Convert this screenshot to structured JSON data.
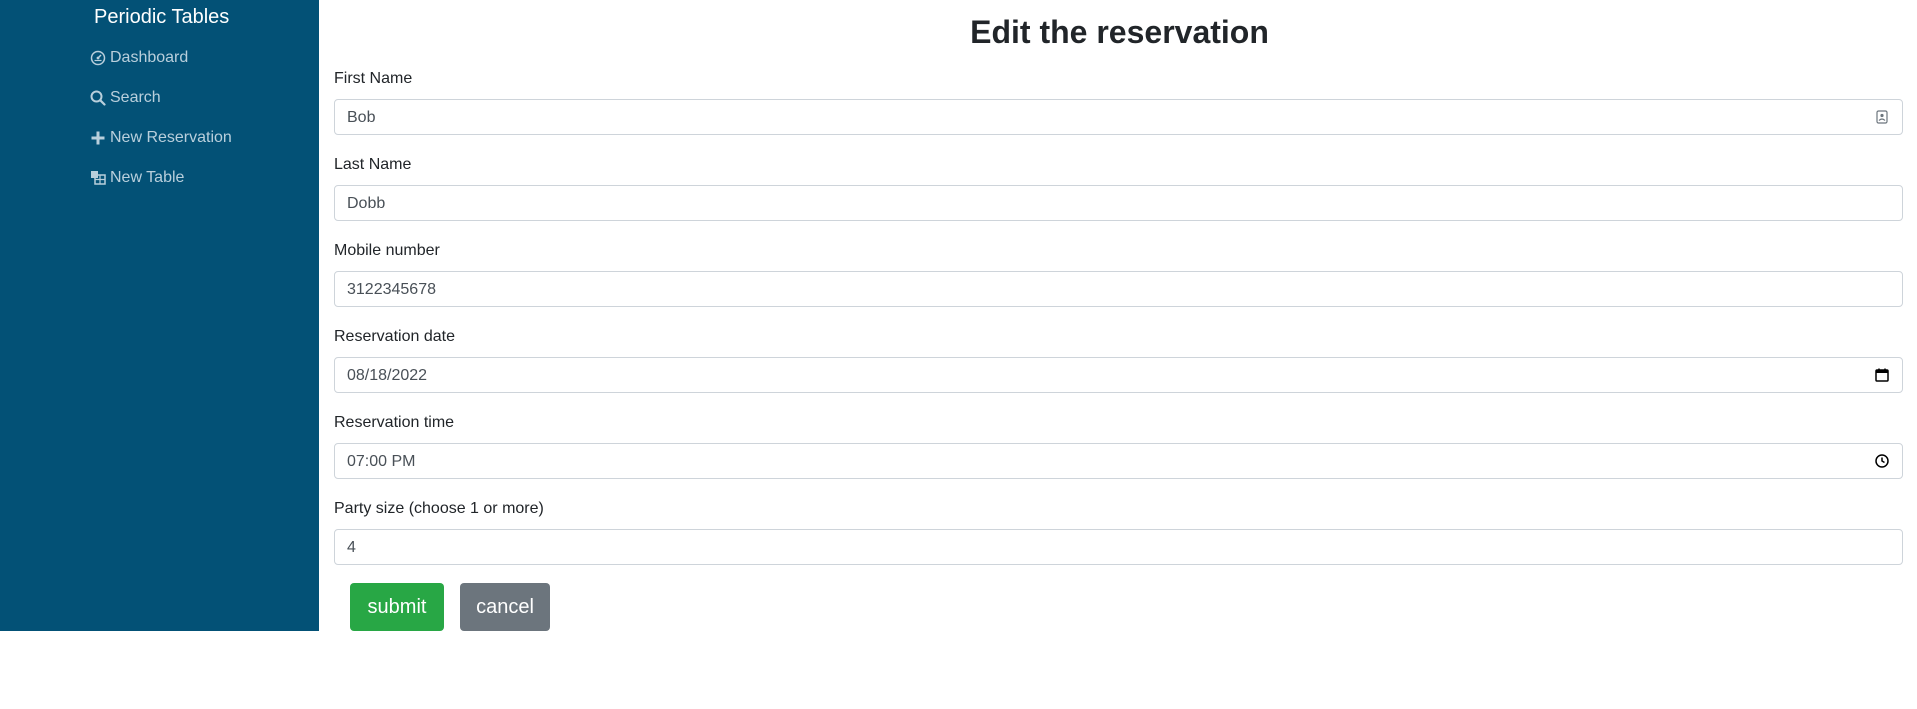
{
  "sidebar": {
    "brand": "Periodic Tables",
    "items": [
      {
        "label": "Dashboard",
        "icon": "dashboard-icon"
      },
      {
        "label": "Search",
        "icon": "search-icon"
      },
      {
        "label": "New Reservation",
        "icon": "plus-icon"
      },
      {
        "label": "New Table",
        "icon": "table-icon"
      }
    ]
  },
  "form": {
    "title": "Edit the reservation",
    "first_name": {
      "label": "First Name",
      "value": "Bob"
    },
    "last_name": {
      "label": "Last Name",
      "value": "Dobb"
    },
    "mobile_number": {
      "label": "Mobile number",
      "value": "3122345678"
    },
    "reservation_date": {
      "label": "Reservation date",
      "value": "08/18/2022"
    },
    "reservation_time": {
      "label": "Reservation time",
      "value": "07:00 PM"
    },
    "people": {
      "label": "Party size (choose 1 or more)",
      "value": "4"
    },
    "submit_label": "submit",
    "cancel_label": "cancel"
  },
  "colors": {
    "sidebar_bg": "#035176",
    "submit": "#28a745",
    "cancel": "#6c757d"
  }
}
